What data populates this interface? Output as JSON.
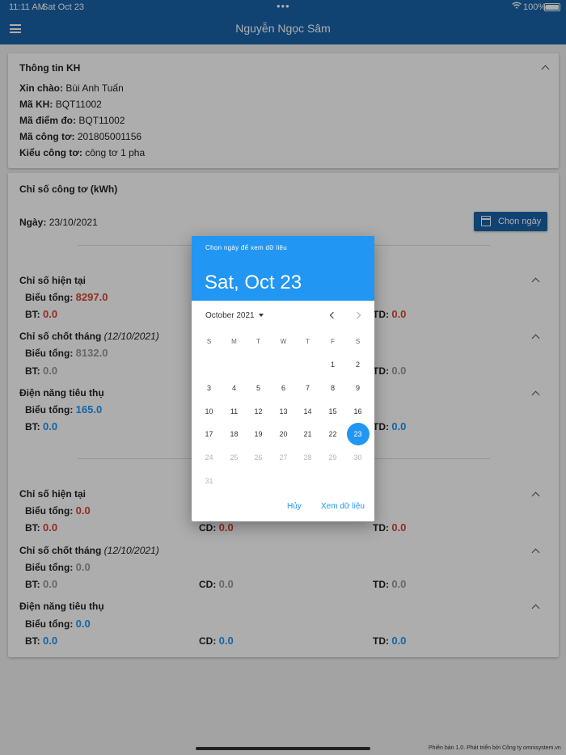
{
  "status_bar": {
    "time": "11:11 AM",
    "date": "Sat Oct 23",
    "battery": "100%"
  },
  "app_bar": {
    "title": "Nguyễn Ngọc Sâm"
  },
  "customer_card": {
    "title": "Thông tin KH",
    "rows": [
      {
        "label": "Xin chào:",
        "value": "Bùi Anh Tuấn"
      },
      {
        "label": "Mã KH:",
        "value": "BQT11002"
      },
      {
        "label": "Mã điểm đo:",
        "value": "BQT11002"
      },
      {
        "label": "Mã công tơ:",
        "value": "201805001156"
      },
      {
        "label": "Kiểu công tơ:",
        "value": "công tơ 1 pha"
      }
    ]
  },
  "meter_card": {
    "title": "Chỉ số công tơ (kWh)",
    "date_label": "Ngày:",
    "date_value": "23/10/2021",
    "choose_date_button": "Chọn ngày",
    "group1": {
      "current": {
        "title": "Chỉ số hiện tại",
        "total_label": "Biểu tổng:",
        "total": "8297.0",
        "bt_label": "BT:",
        "bt": "0.0",
        "td_label": "TD:",
        "td": "0.0"
      },
      "monthly": {
        "title": "Chỉ số chốt tháng",
        "date": "(12/10/2021)",
        "total_label": "Biểu tổng:",
        "total": "8132.0",
        "bt_label": "BT:",
        "bt": "0.0",
        "td_label": "TD:",
        "td": "0.0"
      },
      "consumption": {
        "title": "Điện năng tiêu thụ",
        "total_label": "Biểu tổng:",
        "total": "165.0",
        "bt_label": "BT:",
        "bt": "0.0",
        "td_label": "TD:",
        "td": "0.0"
      }
    },
    "group2": {
      "current": {
        "title": "Chỉ số hiện tại",
        "total_label": "Biểu tổng:",
        "total": "0.0",
        "bt_label": "BT:",
        "bt": "0.0",
        "cd_label": "CD:",
        "cd": "0.0",
        "td_label": "TD:",
        "td": "0.0"
      },
      "monthly": {
        "title": "Chỉ số chốt tháng",
        "date": "(12/10/2021)",
        "total_label": "Biểu tổng:",
        "total": "0.0",
        "bt_label": "BT:",
        "bt": "0.0",
        "cd_label": "CD:",
        "cd": "0.0",
        "td_label": "TD:",
        "td": "0.0"
      },
      "consumption": {
        "title": "Điện năng tiêu thụ",
        "total_label": "Biểu tổng:",
        "total": "0.0",
        "bt_label": "BT:",
        "bt": "0.0",
        "cd_label": "CD:",
        "cd": "0.0",
        "td_label": "TD:",
        "td": "0.0"
      }
    }
  },
  "date_dialog": {
    "help_text": "Chọn ngày để xem dữ liệu",
    "selected_display": "Sat, Oct 23",
    "month_label": "October 2021",
    "weekdays": [
      "S",
      "M",
      "T",
      "W",
      "T",
      "F",
      "S"
    ],
    "days_in_month": 31,
    "first_weekday_index": 5,
    "selected_day": 23,
    "last_enabled_day": 23,
    "cancel_button": "Hủy",
    "confirm_button": "Xem dữ liệu"
  },
  "footer": {
    "text": "Phiên bản 1.0. Phát triển bởi Công ty omnisystem.vn"
  },
  "colors": {
    "primary": "#1a63a9",
    "accent": "#2196f3",
    "red_value": "#d64539",
    "grey_value": "#999999"
  }
}
